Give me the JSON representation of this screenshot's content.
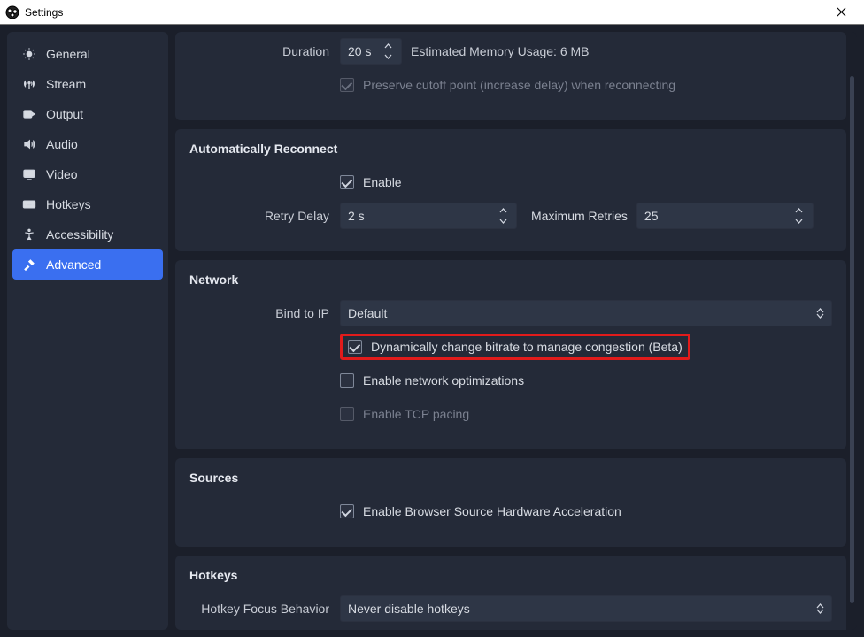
{
  "window": {
    "title": "Settings"
  },
  "sidebar": {
    "items": [
      {
        "label": "General"
      },
      {
        "label": "Stream"
      },
      {
        "label": "Output"
      },
      {
        "label": "Audio"
      },
      {
        "label": "Video"
      },
      {
        "label": "Hotkeys"
      },
      {
        "label": "Accessibility"
      },
      {
        "label": "Advanced"
      }
    ]
  },
  "delaySection": {
    "durationLabel": "Duration",
    "durationValue": "20 s",
    "memoryUsage": "Estimated Memory Usage: 6 MB",
    "preserveCutoff": "Preserve cutoff point (increase delay) when reconnecting"
  },
  "reconnect": {
    "title": "Automatically Reconnect",
    "enable": "Enable",
    "retryDelayLabel": "Retry Delay",
    "retryDelayValue": "2 s",
    "maxRetriesLabel": "Maximum Retries",
    "maxRetriesValue": "25"
  },
  "network": {
    "title": "Network",
    "bindLabel": "Bind to IP",
    "bindValue": "Default",
    "dynBitrate": "Dynamically change bitrate to manage congestion (Beta)",
    "netOpt": "Enable network optimizations",
    "tcpPacing": "Enable TCP pacing"
  },
  "sources": {
    "title": "Sources",
    "browserAccel": "Enable Browser Source Hardware Acceleration"
  },
  "hotkeys": {
    "title": "Hotkeys",
    "behaviorLabel": "Hotkey Focus Behavior",
    "behaviorValue": "Never disable hotkeys"
  }
}
